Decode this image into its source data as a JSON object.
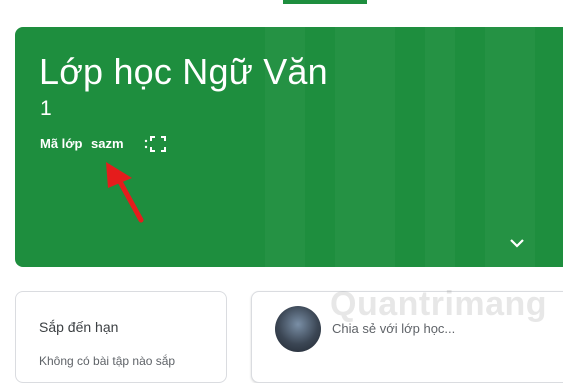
{
  "colors": {
    "banner": "#1e8e3e",
    "banner_text": "#ffffff",
    "arrow": "#e51c1c",
    "card_border": "#dadce0"
  },
  "class_header": {
    "title": "Lớp học Ngữ Văn",
    "section": "1",
    "code_label": "Mã lớp",
    "code_value": "sazm",
    "icons": [
      "more-vert-icon",
      "fullscreen-icon",
      "chevron-down-icon"
    ]
  },
  "upcoming": {
    "title": "Sắp đến hạn",
    "empty_text": "Không có bài tập nào sắp"
  },
  "stream": {
    "share_placeholder": "Chia sẻ với lớp học..."
  },
  "watermark": "Quantrimang"
}
